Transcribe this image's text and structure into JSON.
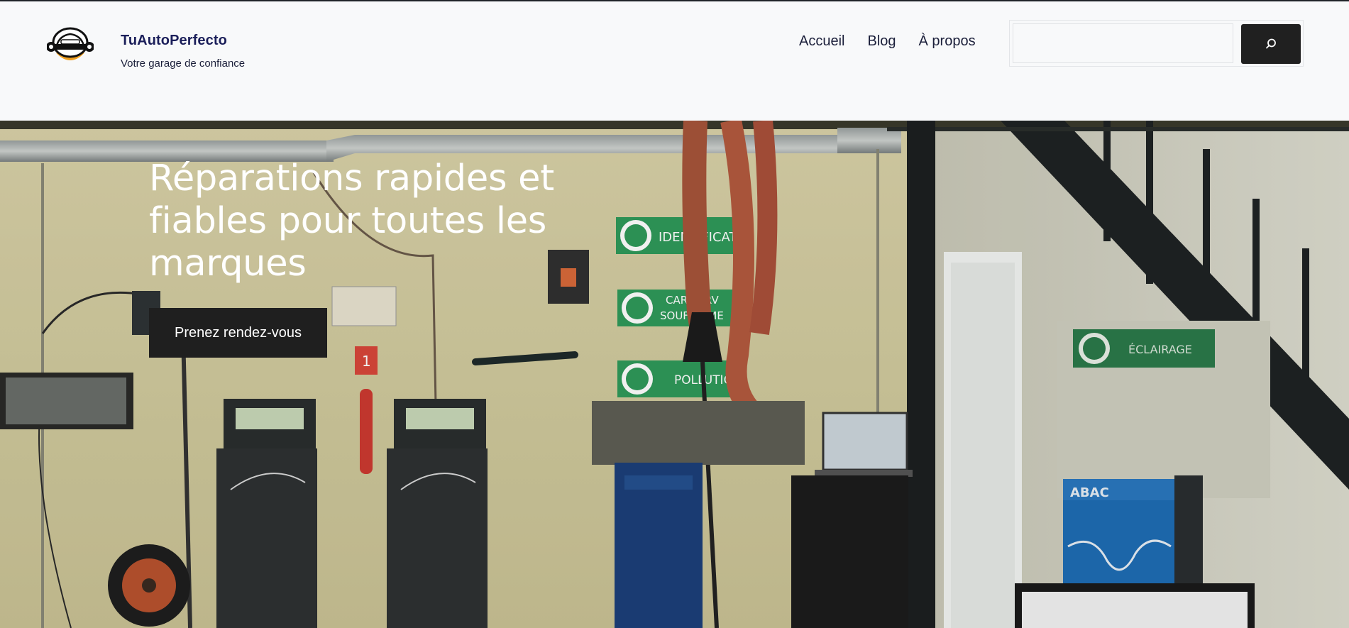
{
  "site": {
    "title": "TuAutoPerfecto",
    "tagline": "Votre garage de confiance"
  },
  "nav": {
    "items": [
      {
        "label": "Accueil"
      },
      {
        "label": "Blog"
      },
      {
        "label": "À propos"
      }
    ]
  },
  "search": {
    "value": "",
    "placeholder": "",
    "icon": "search-icon"
  },
  "hero": {
    "title": "Réparations rapides et fiables pour toutes les marques",
    "cta_label": "Prenez rendez-vous"
  },
  "background_signs": {
    "sign1": "IDENTIFICATI",
    "sign2a": "CAR SERV",
    "sign2b": "SOUFFLEME",
    "sign3": "POLLUTION",
    "sign4": "ÉCLAIRAGE",
    "brand": "ABAC",
    "counter": "1"
  },
  "colors": {
    "brand_dark": "#1b1f5a",
    "button_bg": "#1f1f1f",
    "header_bg": "#f8f9fa",
    "sign_green": "#2f9a5a"
  }
}
